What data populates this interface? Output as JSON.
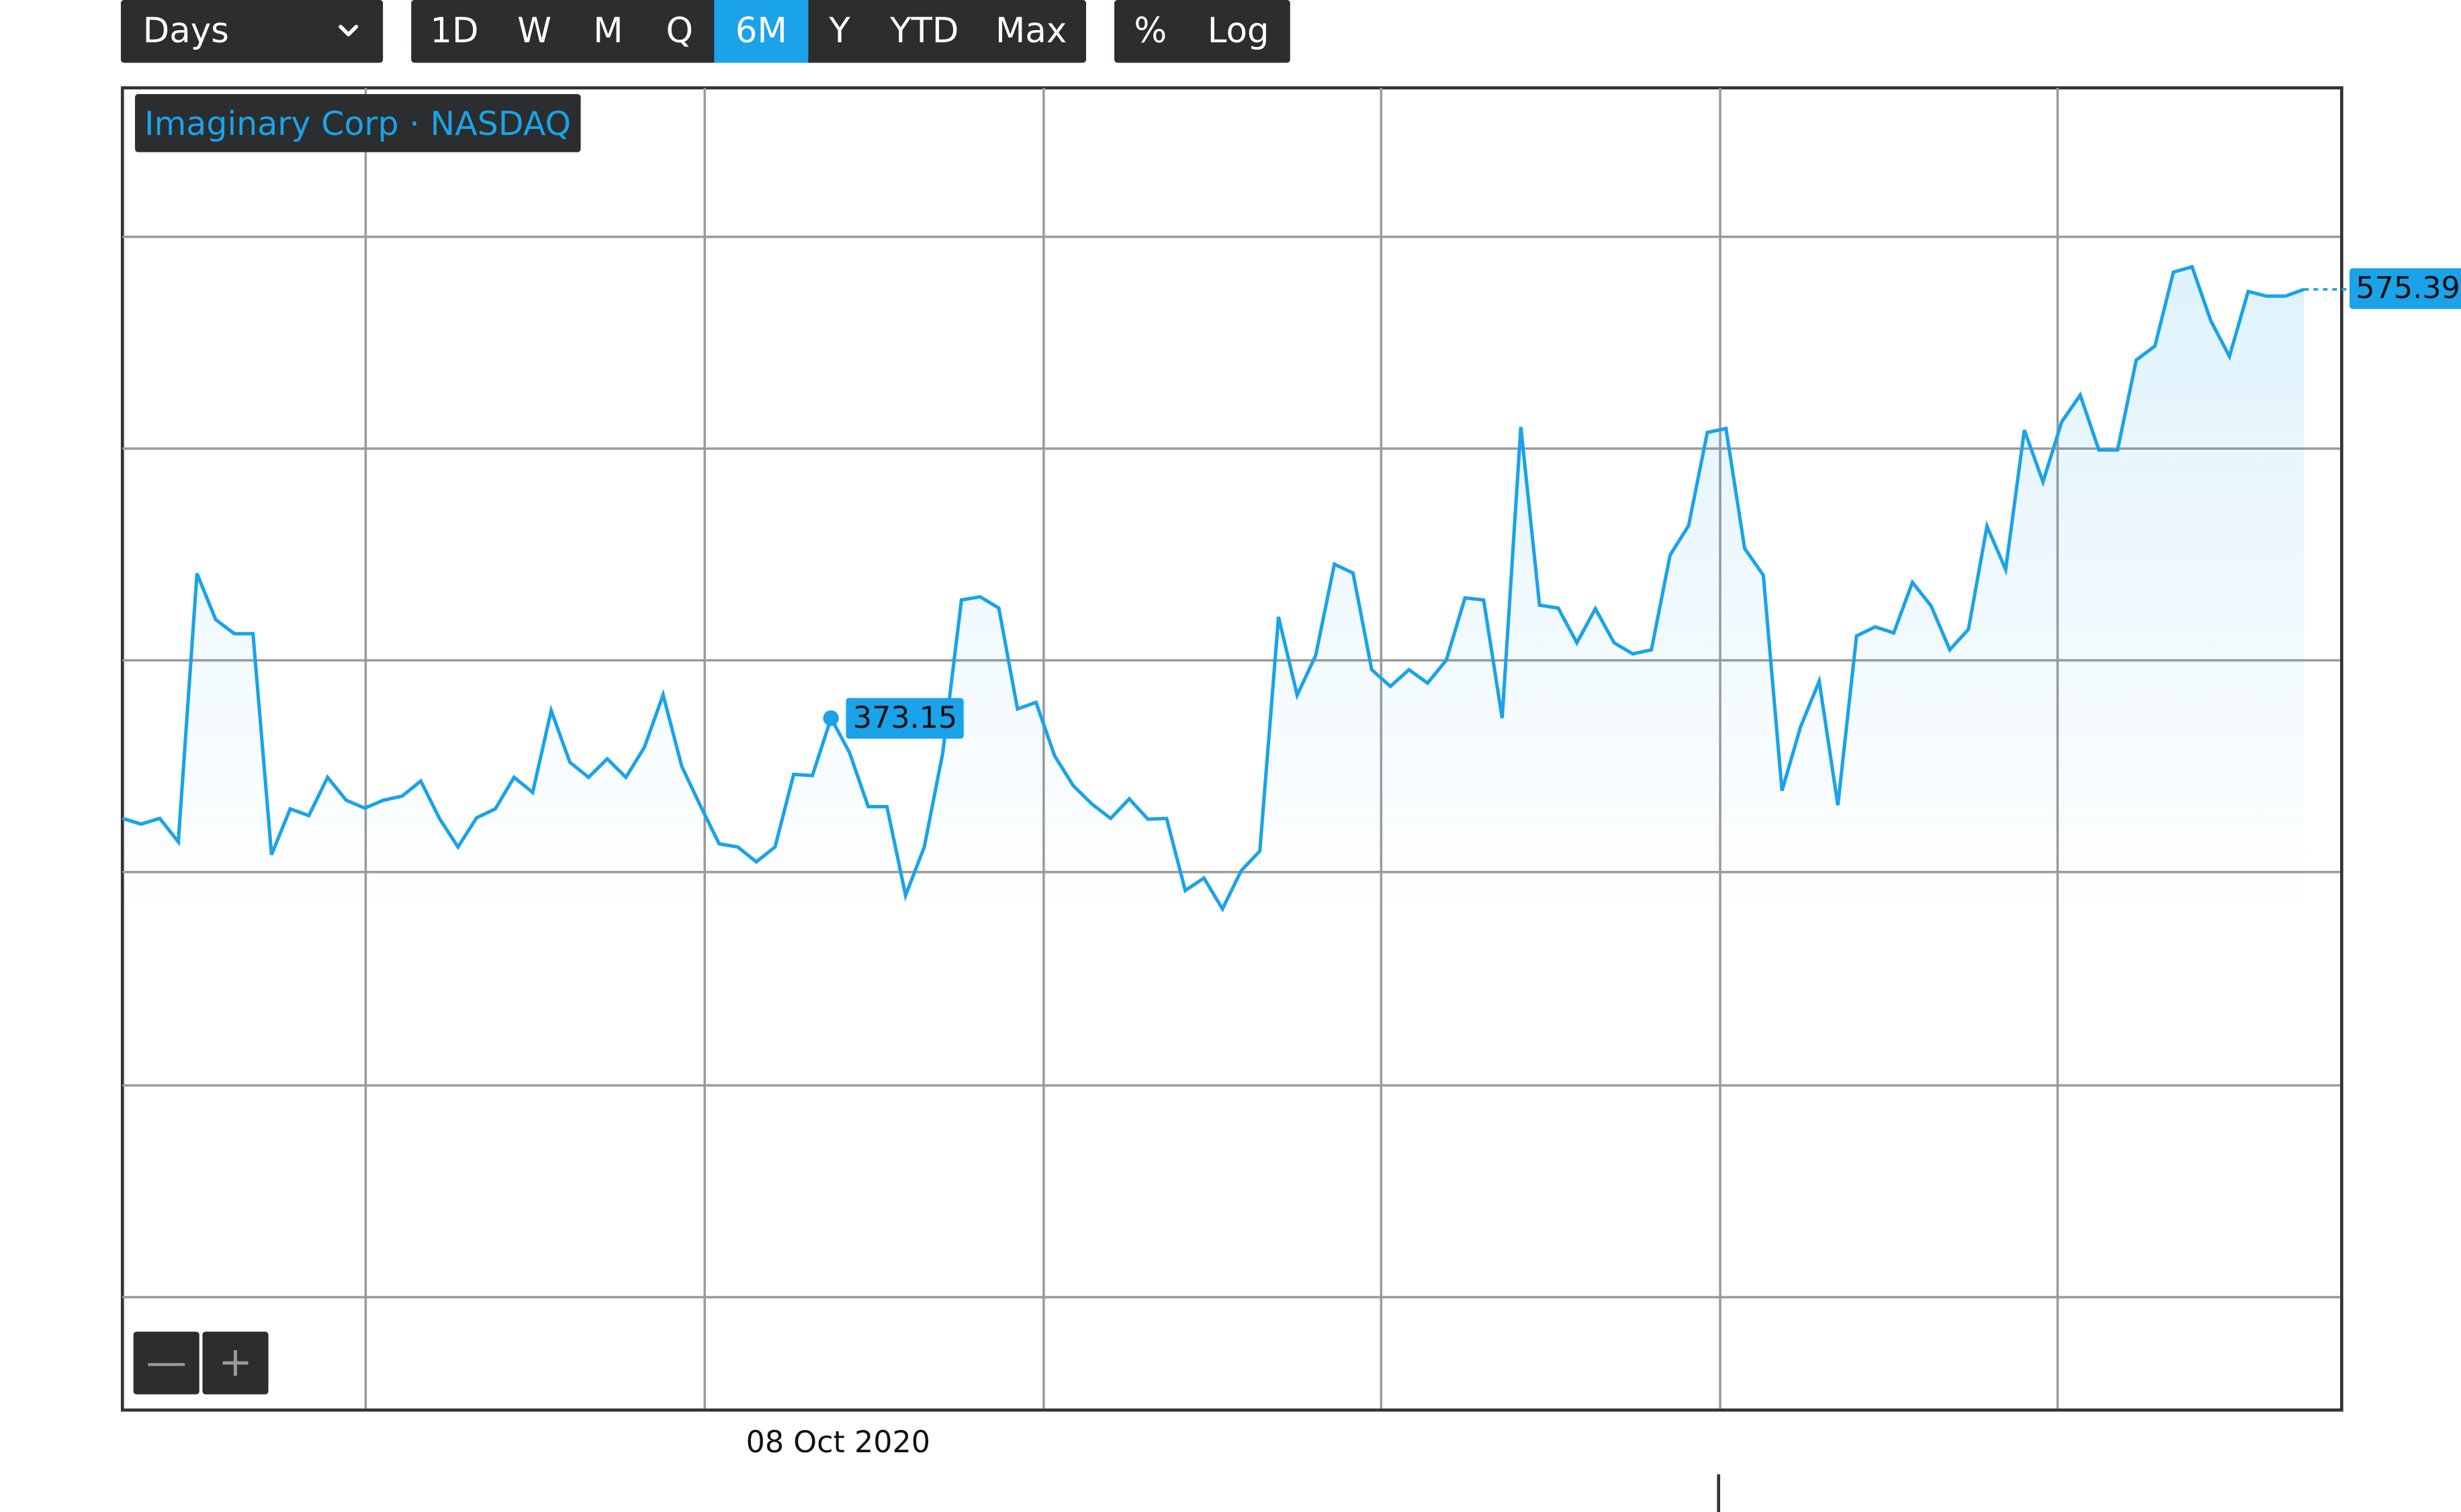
{
  "toolbar": {
    "interval_select": "Days",
    "ranges": [
      "1D",
      "W",
      "M",
      "Q",
      "6M",
      "Y",
      "YTD",
      "Max"
    ],
    "active_range": "6M",
    "modes": [
      "%",
      "Log"
    ]
  },
  "legend": {
    "label": "Imaginary Corp · NASDAQ"
  },
  "zoom": {
    "minus": "—",
    "plus": "+"
  },
  "colors": {
    "accent": "#1aa3e8",
    "control_bg": "#2b2d2e",
    "grid": "#9a9a9a"
  },
  "chart_data": {
    "type": "area",
    "title": "",
    "xlabel": "",
    "ylabel": "",
    "x_ticks": [
      "08 Oct 2020"
    ],
    "markers": [
      {
        "label": "373.15",
        "value": 373.15
      },
      {
        "label": "575.39",
        "value": 575.39
      }
    ],
    "grid": true,
    "series": [
      {
        "values": [
          325.9,
          323.2,
          325.9,
          314.9,
          441.4,
          419.7,
          413.0,
          413.0,
          308.8,
          330.4,
          327.2,
          345.3,
          334.5,
          330.8,
          334.5,
          336.4,
          343.5,
          325.9,
          312.4,
          326.2,
          330.4,
          345.3,
          338.2,
          376.8,
          352.4,
          345.3,
          354.0,
          345.3,
          359.5,
          384.2,
          350.4,
          331.8,
          313.9,
          312.4,
          305.4,
          312.4,
          346.7,
          346.1,
          373.15,
          356.9,
          331.4,
          331.4,
          289.6,
          312.4,
          356.9,
          428.9,
          430.4,
          425.1,
          377.5,
          380.6,
          355.3,
          341.3,
          332.6,
          325.9,
          335.1,
          325.5,
          325.9,
          291.9,
          297.8,
          283.2,
          301.2,
          310.5,
          420.9,
          384.0,
          402.8,
          445.8,
          441.6,
          396.0,
          388.2,
          396.0,
          389.7,
          400.5,
          429.9,
          428.9,
          373.2,
          510.5,
          426.5,
          425.1,
          408.7,
          424.8,
          408.7,
          403.5,
          405.4,
          450.1,
          464.0,
          507.9,
          509.8,
          453.2,
          440.6,
          339.0,
          369.0,
          390.6,
          332.1,
          412.0,
          416.2,
          413.4,
          437.2,
          426.1,
          405.4,
          415.1,
          463.7,
          443.3,
          509.0,
          484.6,
          512.9,
          525.5,
          499.6,
          499.6,
          542.0,
          548.7,
          583.5,
          586.0,
          560.6,
          543.8,
          574.4,
          572.2,
          572.2,
          575.39
        ]
      }
    ]
  }
}
